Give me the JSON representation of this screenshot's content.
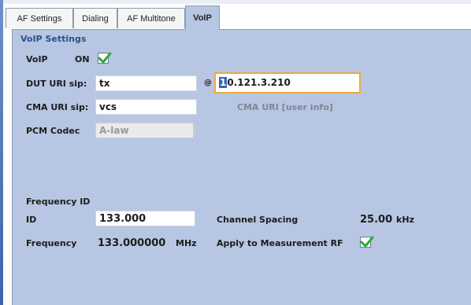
{
  "tabs": [
    {
      "label": "AF Settings",
      "active": false
    },
    {
      "label": "Dialing",
      "active": false
    },
    {
      "label": "AF Multitone",
      "active": false
    },
    {
      "label": "VoIP",
      "active": true
    }
  ],
  "voip_settings": {
    "title": "VoIP Settings",
    "voip_label": "VoIP",
    "voip_state": "ON",
    "voip_checked": true,
    "dut_uri_label": "DUT URI  sip:",
    "dut_uri_user": "tx",
    "at_sign": "@",
    "dut_uri_host_caret": "1",
    "dut_uri_host_rest": "0.121.3.210",
    "cma_uri_label": "CMA URI  sip:",
    "cma_uri_user": "vcs",
    "cma_uri_hint": "CMA URI [user info]",
    "pcm_codec_label": "PCM Codec",
    "pcm_codec_value": "A-law"
  },
  "frequency_id": {
    "title": "Frequency ID",
    "id_label": "ID",
    "id_value": "133.000",
    "channel_spacing_label": "Channel Spacing",
    "channel_spacing_value": "25.00",
    "channel_spacing_unit": "kHz",
    "frequency_label": "Frequency",
    "frequency_value": "133.000000",
    "frequency_unit": "MHz",
    "apply_label": "Apply to Measurement RF",
    "apply_checked": true
  },
  "colors": {
    "panel_bg": "#b7c6e2",
    "accent_blue": "#2c4f8e",
    "focus_orange": "#f0a93a",
    "check_green": "#2eaa3a"
  }
}
